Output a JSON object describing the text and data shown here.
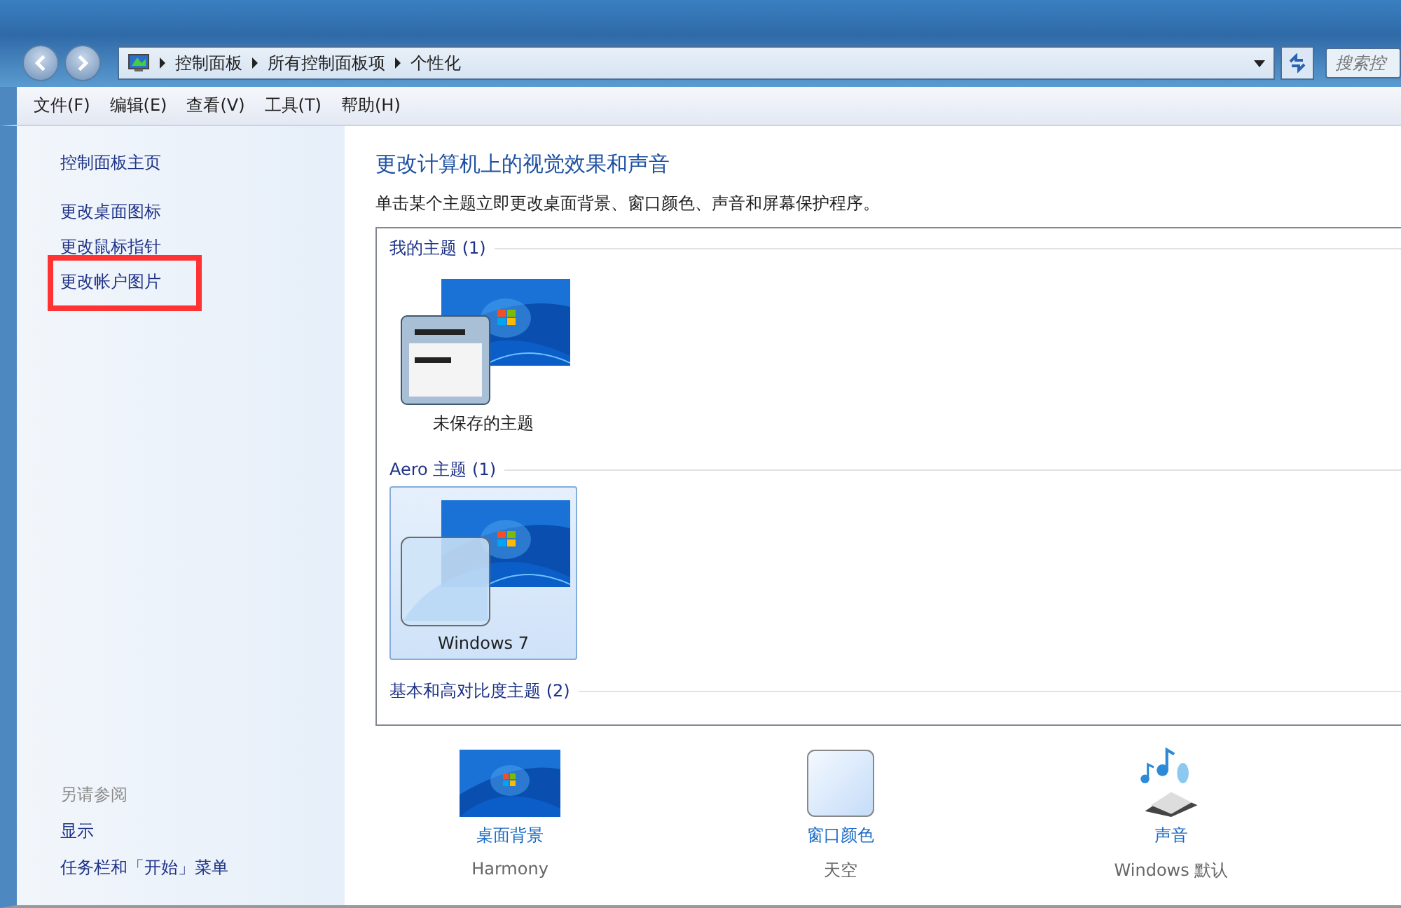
{
  "address_bar": {
    "breadcrumb": [
      "控制面板",
      "所有控制面板项",
      "个性化"
    ],
    "search": {
      "placeholder": "搜索控"
    }
  },
  "menu": [
    "文件(F)",
    "编辑(E)",
    "查看(V)",
    "工具(T)",
    "帮助(H)"
  ],
  "sidebar": {
    "items": [
      {
        "label": "控制面板主页",
        "annotated": false
      },
      {
        "label": "更改桌面图标",
        "annotated": false
      },
      {
        "label": "更改鼠标指针",
        "annotated": false
      },
      {
        "label": "更改帐户图片",
        "annotated": true
      }
    ],
    "see_also": {
      "title": "另请参阅",
      "links": [
        "显示",
        "任务栏和「开始」菜单"
      ]
    }
  },
  "main": {
    "title": "更改计算机上的视觉效果和声音",
    "description": "单击某个主题立即更改桌面背景、窗口颜色、声音和屏幕保护程序。",
    "groups": [
      {
        "title": "我的主题 (1)",
        "themes": [
          {
            "name": "未保存的主题",
            "kind": "custom",
            "selected": false
          }
        ]
      },
      {
        "title": "Aero 主题 (1)",
        "themes": [
          {
            "name": "Windows 7",
            "kind": "aero",
            "selected": true
          }
        ]
      },
      {
        "title": "基本和高对比度主题 (2)"
      }
    ],
    "settings": [
      {
        "kind": "background",
        "label": "桌面背景",
        "value": "Harmony"
      },
      {
        "kind": "color",
        "label": "窗口颜色",
        "value": "天空"
      },
      {
        "kind": "sound",
        "label": "声音",
        "value": "Windows 默认"
      }
    ]
  }
}
